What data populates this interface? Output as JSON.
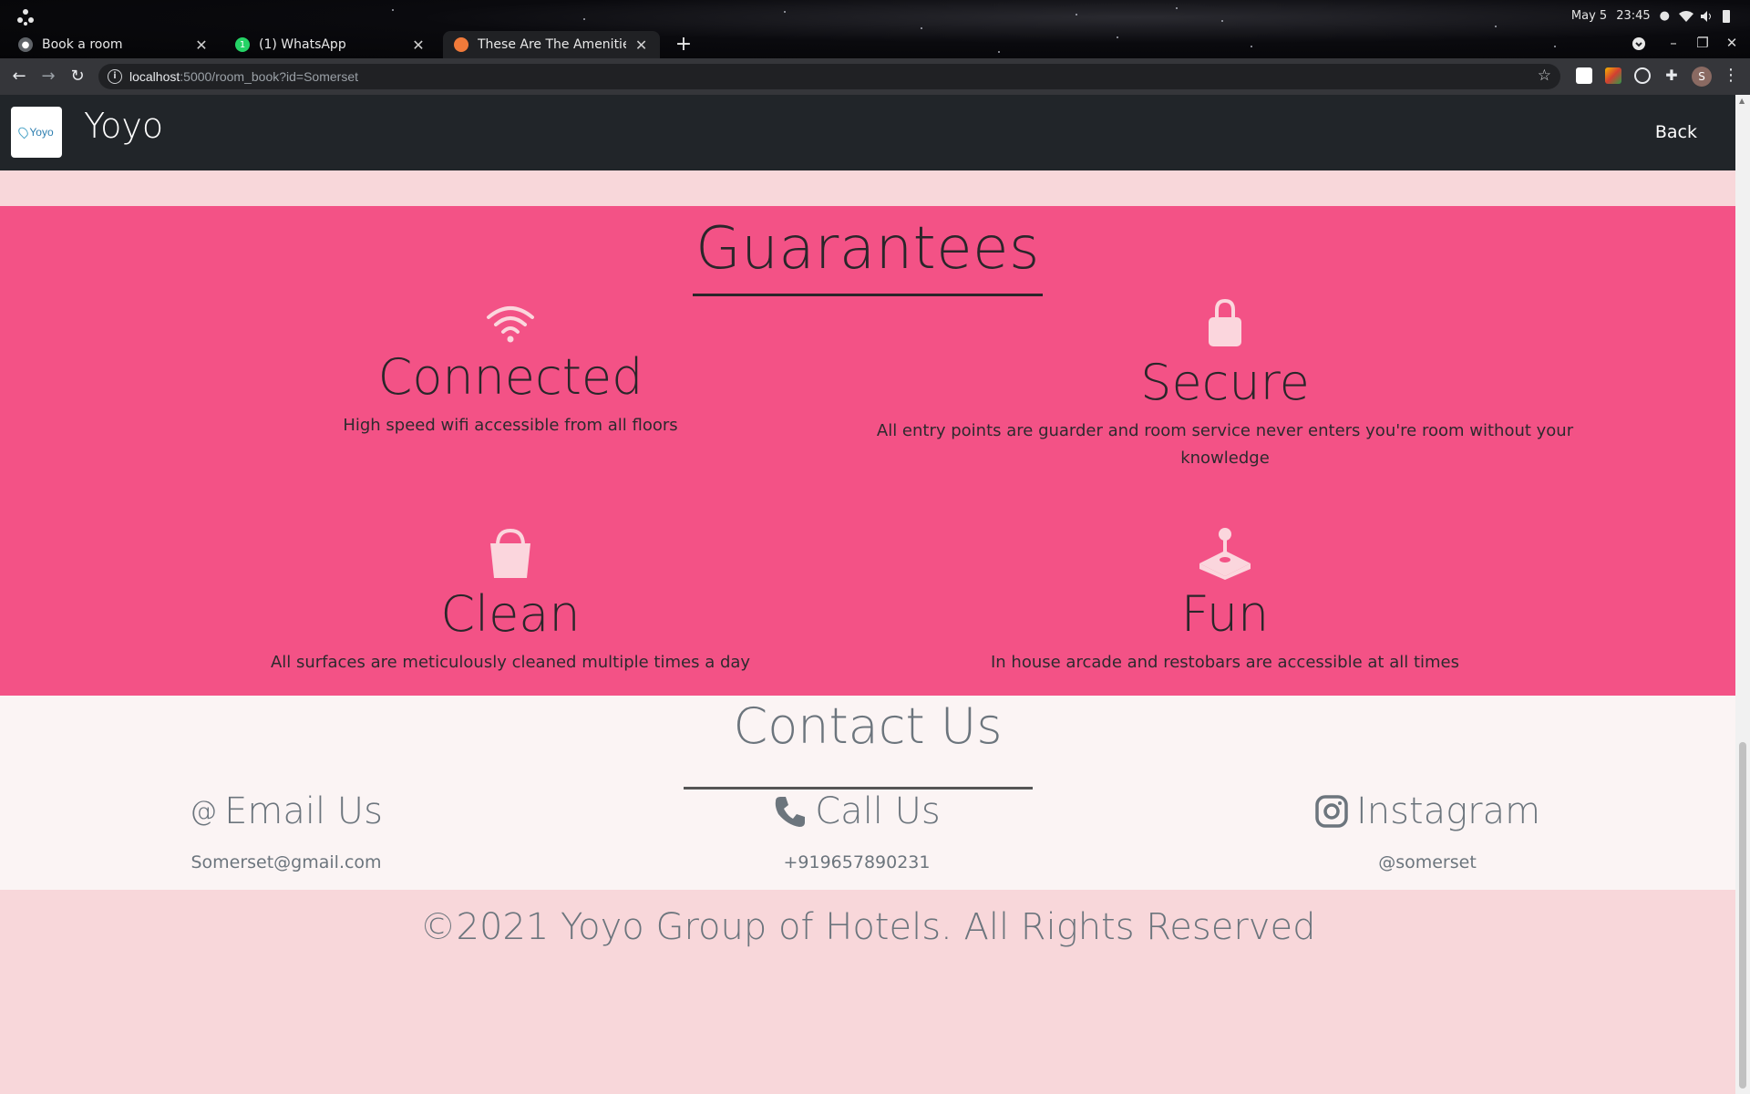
{
  "system": {
    "date": "May 5",
    "time": "23:45"
  },
  "tabs": [
    {
      "label": "Book a room",
      "favicon": "globe-icon",
      "active": false
    },
    {
      "label": "(1) WhatsApp",
      "favicon": "whatsapp-icon",
      "active": false
    },
    {
      "label": "These Are The Amenities",
      "favicon": "site-icon",
      "active": true
    }
  ],
  "address_bar": {
    "host": "localhost",
    "path": ":5000/room_book?id=Somerset"
  },
  "profile_initial": "S",
  "navbar": {
    "logo_text": "Yoyo",
    "brand": "Yoyo",
    "back_label": "Back"
  },
  "guarantees": {
    "title": "Guarantees",
    "items": [
      {
        "icon": "wifi-icon",
        "name": "Connected",
        "description": "High speed wifi accessible from all floors"
      },
      {
        "icon": "lock-icon",
        "name": "Secure",
        "description": "All entry points are guarder and room service never enters you're room without your knowledge"
      },
      {
        "icon": "bucket-icon",
        "name": "Clean",
        "description": "All surfaces are meticulously cleaned multiple times a day"
      },
      {
        "icon": "joystick-icon",
        "name": "Fun",
        "description": "In house arcade and restobars are accessible at all times"
      }
    ]
  },
  "contact": {
    "title": "Contact Us",
    "email": {
      "icon": "at-icon",
      "label": "Email Us",
      "value": "Somerset@gmail.com"
    },
    "phone": {
      "icon": "phone-icon",
      "label": "Call Us",
      "value": "+919657890231"
    },
    "instagram": {
      "icon": "instagram-icon",
      "label": "Instagram",
      "value": "@somerset"
    }
  },
  "footer": {
    "copyright": "©2021 Yoyo Group of Hotels. All Rights Reserved"
  },
  "colors": {
    "guarantees_bg": "#f35286",
    "navbar_bg": "#212529",
    "light_pink": "#f8d7da",
    "icon_fill": "#fbd6dd"
  }
}
